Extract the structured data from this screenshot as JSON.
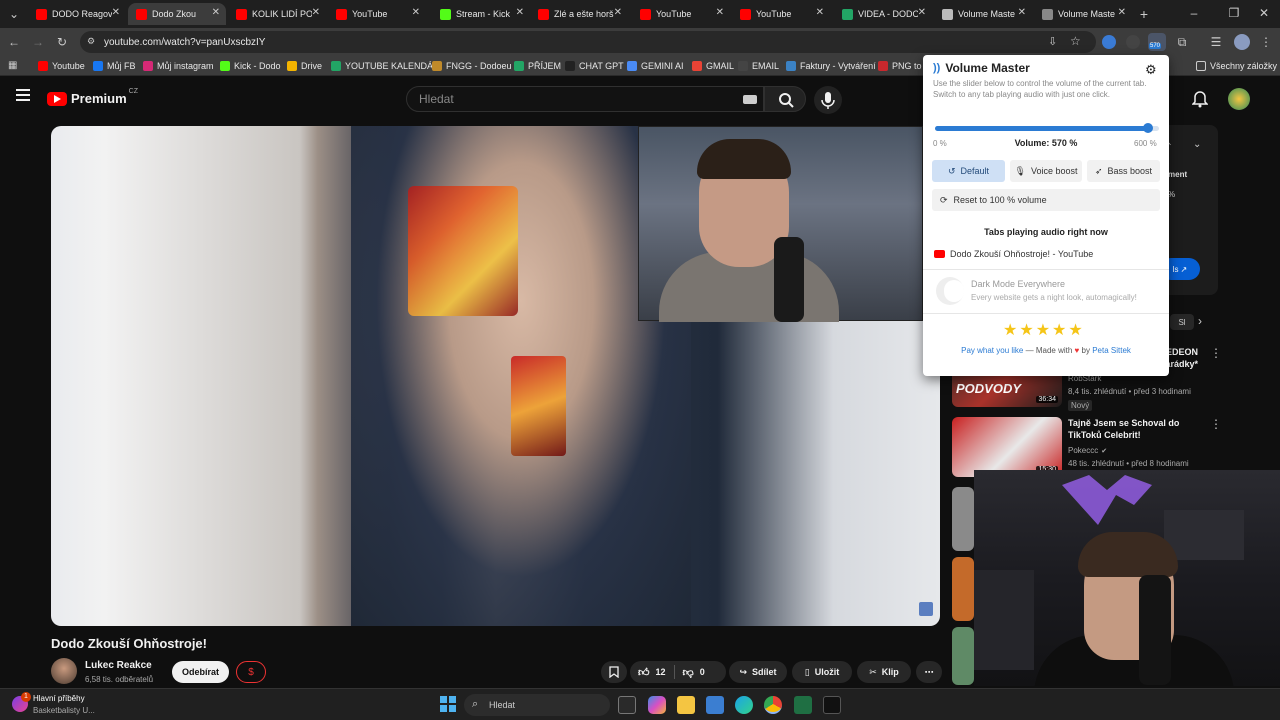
{
  "browser": {
    "tabs": [
      {
        "title": "DODO Reagov",
        "color": "#ff0000",
        "active": false
      },
      {
        "title": "Dodo Zkou",
        "color": "#ff0000",
        "active": true
      },
      {
        "title": "KOLIK LIDÍ PO",
        "color": "#ff0000",
        "active": false
      },
      {
        "title": "YouTube",
        "color": "#ff0000",
        "active": false
      },
      {
        "title": "Stream - Kick",
        "color": "#53fc18",
        "active": false
      },
      {
        "title": "Zlé a ešte horš",
        "color": "#ff0000",
        "active": false
      },
      {
        "title": "YouTube",
        "color": "#ff0000",
        "active": false
      },
      {
        "title": "YouTube",
        "color": "#ff0000",
        "active": false
      },
      {
        "title": "VIDEA - DODO",
        "color": "#22a565",
        "active": false
      },
      {
        "title": "Volume Maste",
        "color": "#bbbbbb",
        "active": false
      },
      {
        "title": "Volume Maste",
        "color": "#888888",
        "active": false
      }
    ],
    "url": "youtube.com/watch?v=panUxscbzIY",
    "extension_badge": "570",
    "bookmarks": [
      {
        "label": "Youtube",
        "color": "#ff0000"
      },
      {
        "label": "Můj FB",
        "color": "#1877f2"
      },
      {
        "label": "Můj instagram",
        "color": "#d62976"
      },
      {
        "label": "Kick - Dodo",
        "color": "#53fc18"
      },
      {
        "label": "Drive",
        "color": "#f4b400"
      },
      {
        "label": "YOUTUBE KALENDÁŘ",
        "color": "#22a565"
      },
      {
        "label": "FNGG - Dodoeu",
        "color": "#c08a2a"
      },
      {
        "label": "PŘÍJEM",
        "color": "#22a565"
      },
      {
        "label": "CHAT GPT",
        "color": "#222222"
      },
      {
        "label": "GEMINI AI",
        "color": "#4a8bf5"
      },
      {
        "label": "GMAIL",
        "color": "#ea4335"
      },
      {
        "label": "EMAIL",
        "color": "#444444"
      },
      {
        "label": "Faktury - Vytváření",
        "color": "#3b82c4"
      },
      {
        "label": "PNG to E",
        "color": "#c8282d"
      }
    ],
    "all_bookmarks": "Všechny záložky"
  },
  "youtube": {
    "logo_text": "Premium",
    "logo_region": "CZ",
    "search_placeholder": "Hledat",
    "video_title": "Dodo Zkouší Ohňostroje!",
    "channel_name": "Lukec Reakce",
    "subscribers": "6,58 tis. odběratelů",
    "subscribe_label": "Odebírat",
    "donate_label": "$",
    "likes": "12",
    "dislikes": "0",
    "share_label": "Sdílet",
    "save_label": "Uložit",
    "clip_label": "Klip",
    "more_label": "⋯",
    "sidebar": {
      "tail_text_1": "ment",
      "tail_text_2": "%",
      "tail_link": "ls",
      "chip_text": "Sl",
      "recommendations": [
        {
          "title_line1": "EDEON",
          "title_line2": "arádky*",
          "channel": "RobStark",
          "meta": "8,4 tis. zhlédnutí • před 3 hodinami",
          "badge": "Nový",
          "duration": "36:34",
          "thumb_text": "PODVODY"
        },
        {
          "title_line1": "Tajně Jsem se Schoval do",
          "title_line2": "TikToků Celebrit!",
          "channel": "Pokeccc",
          "meta": "48 tis. zhlédnutí • před 8 hodinami",
          "badge": "",
          "duration": "15:30",
          "thumb_text": ""
        }
      ]
    }
  },
  "popup": {
    "title": "Volume Master",
    "description": "Use the slider below to control the volume of the current tab. Switch to any tab playing audio with just one click.",
    "volume_label": "Volume: 570 %",
    "volume_fraction": 0.95,
    "min_label": "0 %",
    "max_label": "600 %",
    "buttons": {
      "default": "Default",
      "voice": "Voice boost",
      "bass": "Bass boost",
      "reset": "Reset to 100 % volume"
    },
    "tabs_heading": "Tabs playing audio right now",
    "playing_tab": "Dodo Zkouší Ohňostroje! - YouTube",
    "promo_title": "Dark Mode Everywhere",
    "promo_desc": "Every website gets a night look, automagically!",
    "rating": 5,
    "footer_link": "Pay what you like",
    "footer_mid": "— Made with",
    "footer_heart": "♥",
    "footer_by": "by",
    "footer_author": "Peta Sittek",
    "accent": "#2b7bd3"
  },
  "taskbar": {
    "news_title": "Hlavní příběhy",
    "news_sub": "Basketbalisty U...",
    "news_badge": "1",
    "search_placeholder": "Hledat"
  }
}
